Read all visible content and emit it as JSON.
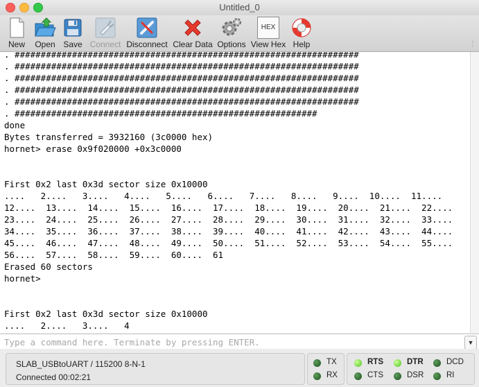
{
  "window": {
    "title": "Untitled_0"
  },
  "toolbar": {
    "new": "New",
    "open": "Open",
    "save": "Save",
    "connect": "Connect",
    "disconnect": "Disconnect",
    "clear_data": "Clear Data",
    "options": "Options",
    "view_hex": "View Hex",
    "view_hex_icon_text": "HEX",
    "help": "Help"
  },
  "terminal": {
    "text": ". ##################################################################\n. ##################################################################\n. ##################################################################\n. ##################################################################\n. ##################################################################\n. ##########################################################\ndone\nBytes transferred = 3932160 (3c0000 hex)\nhornet> erase 0x9f020000 +0x3c0000\n\n\nFirst 0x2 last 0x3d sector size 0x10000\n....   2....   3....   4....   5....   6....   7....   8....   9....  10....  11....\n12....  13....  14....  15....  16....  17....  18....  19....  20....  21....  22....\n23....  24....  25....  26....  27....  28....  29....  30....  31....  32....  33....\n34....  35....  36....  37....  38....  39....  40....  41....  42....  43....  44....\n45....  46....  47....  48....  49....  50....  51....  52....  53....  54....  55....\n56....  57....  58....  59....  60....  61\nErased 60 sectors\nhornet>\n\n\nFirst 0x2 last 0x3d sector size 0x10000\n....   2....   3....   4"
  },
  "command": {
    "placeholder": "Type a command here. Terminate by pressing ENTER."
  },
  "status": {
    "port": "SLAB_USBtoUART / 115200 8-N-1",
    "connected": "Connected 00:02:21",
    "leds": {
      "tx": "TX",
      "rx": "RX",
      "rts": "RTS",
      "cts": "CTS",
      "dtr": "DTR",
      "dsr": "DSR",
      "dcd": "DCD",
      "ri": "RI"
    }
  },
  "colors": {
    "led_on": "#6fe03a",
    "led_off": "#2f6b2f",
    "close": "#fc605b",
    "minimize": "#fdbc40",
    "maximize": "#34c84a"
  }
}
